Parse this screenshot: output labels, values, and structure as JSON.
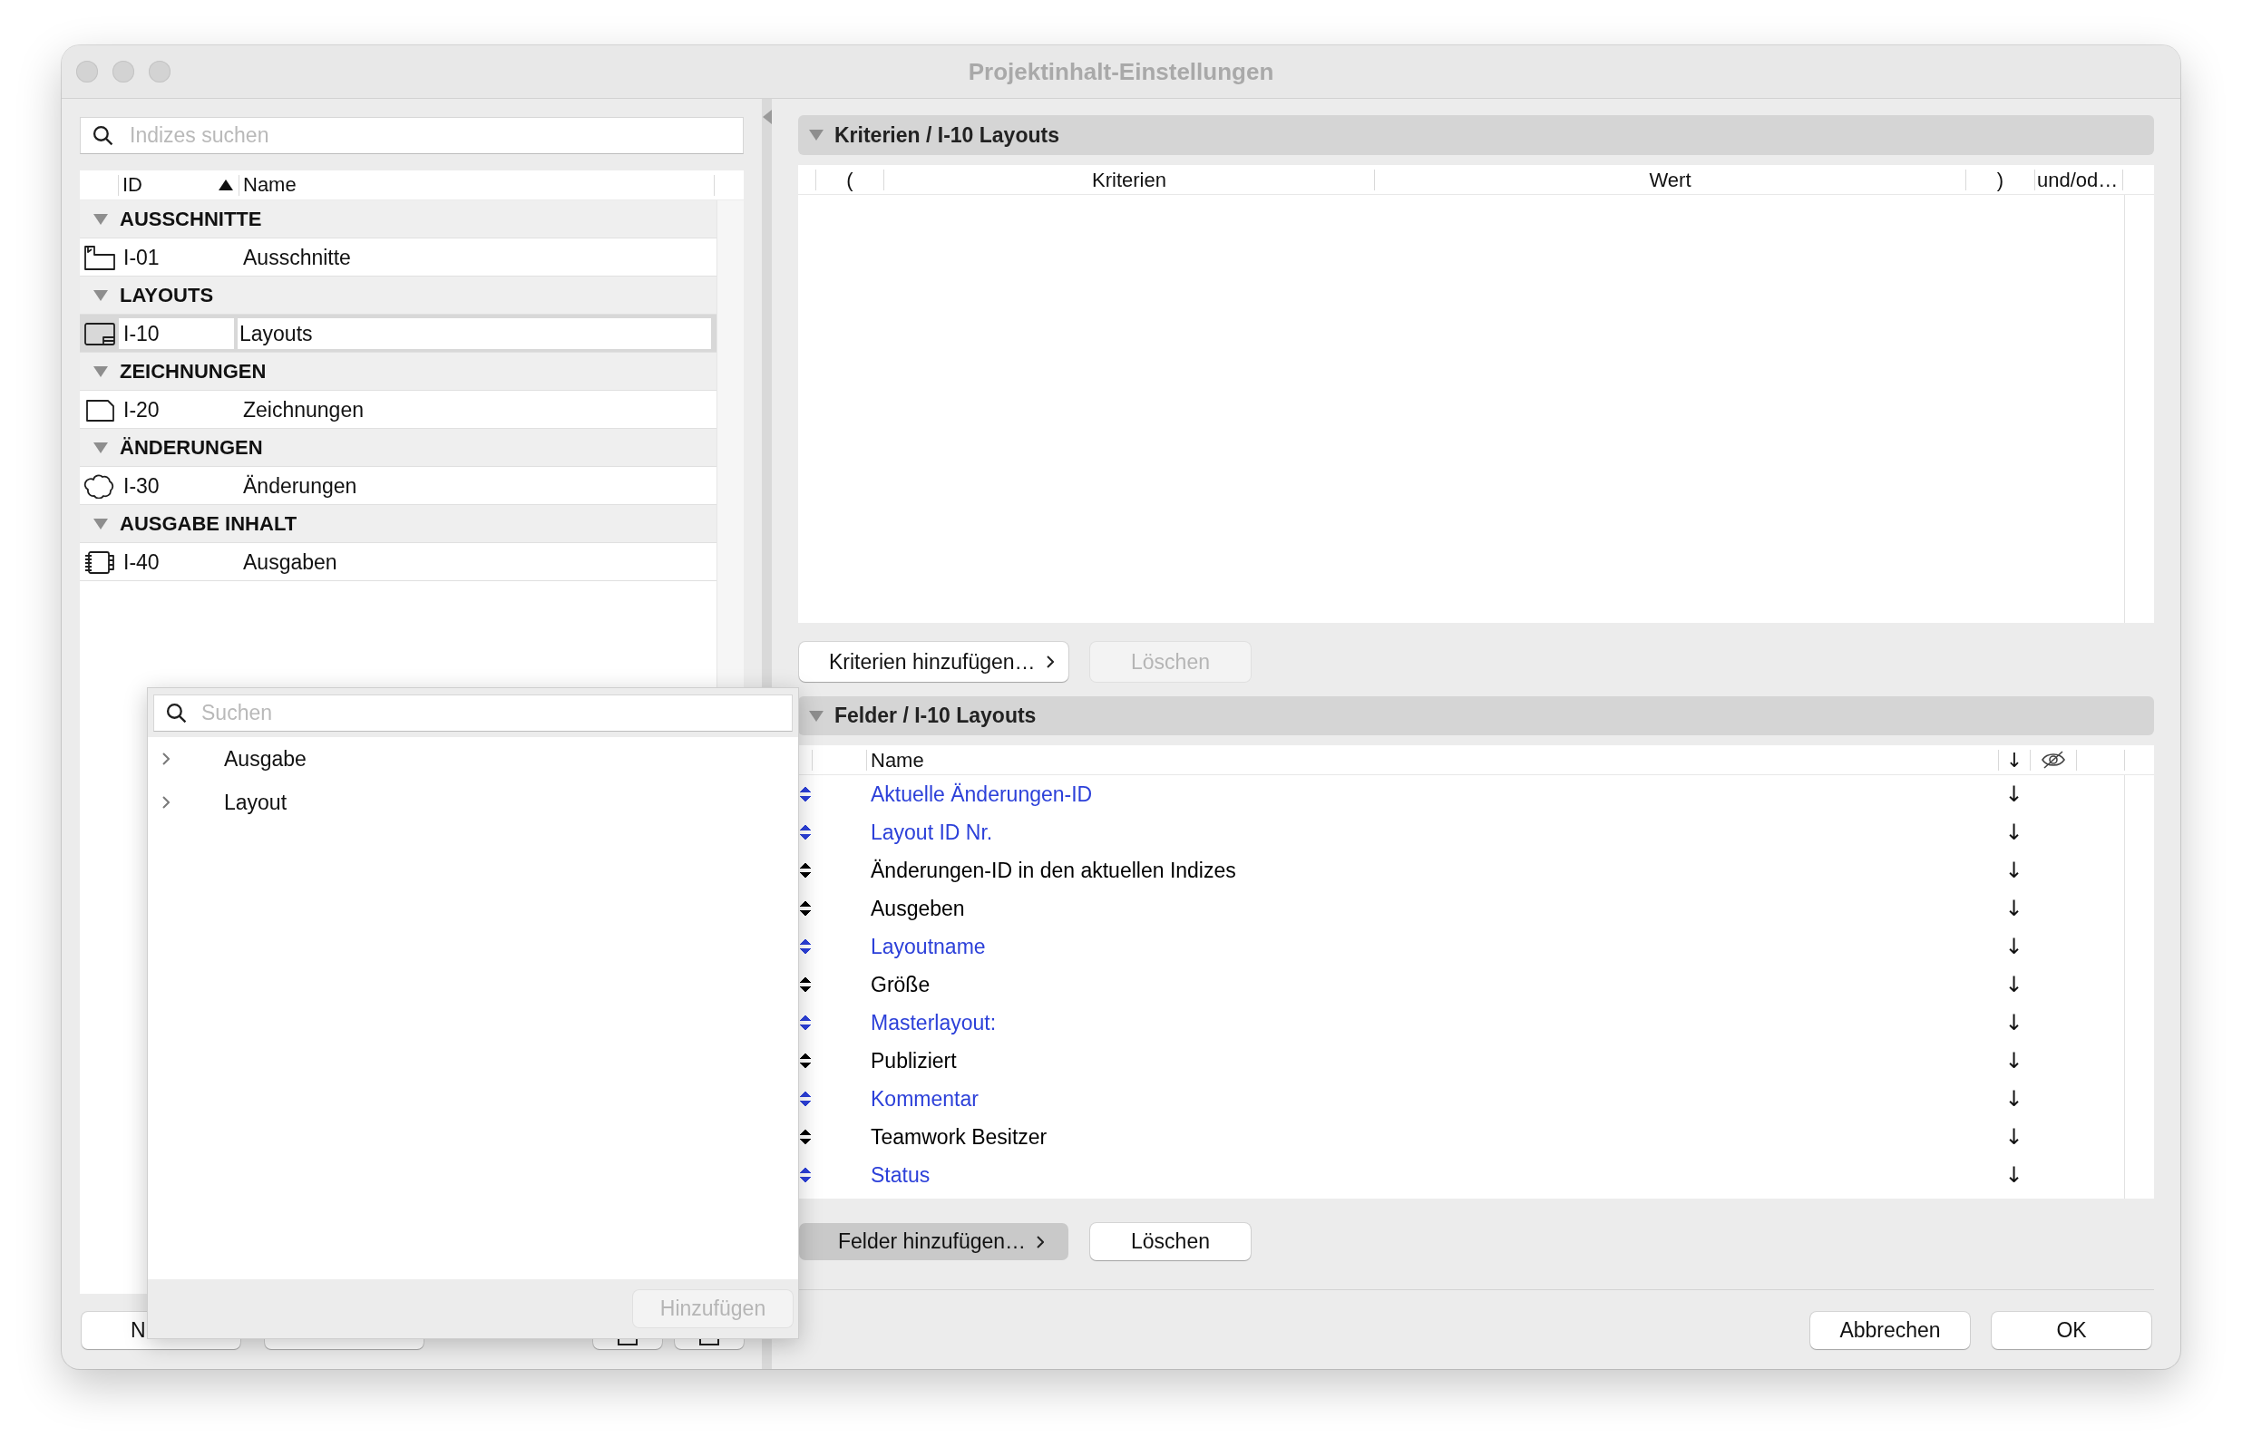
{
  "window": {
    "title": "Projektinhalt-Einstellungen"
  },
  "index_panel": {
    "search": {
      "placeholder": "Indizes suchen"
    },
    "columns": [
      {
        "label": "ID",
        "sorted": true
      },
      {
        "label": "Name",
        "sorted": false
      }
    ],
    "groups": [
      {
        "label": "AUSSCHNITTE",
        "expanded": true,
        "items": [
          {
            "kind": "detail",
            "id": "I-01",
            "name": "Ausschnitte",
            "selected": false
          }
        ]
      },
      {
        "label": "LAYOUTS",
        "expanded": true,
        "items": [
          {
            "kind": "layout",
            "id": "I-10",
            "name": "Layouts",
            "selected": true
          }
        ]
      },
      {
        "label": "ZEICHNUNGEN",
        "expanded": true,
        "items": [
          {
            "kind": "drawing",
            "id": "I-20",
            "name": "Zeichnungen",
            "selected": false
          }
        ]
      },
      {
        "label": "ÄNDERUNGEN",
        "expanded": true,
        "items": [
          {
            "kind": "revision",
            "id": "I-30",
            "name": "Änderungen",
            "selected": false
          }
        ]
      },
      {
        "label": "AUSGABE INHALT",
        "expanded": true,
        "items": [
          {
            "kind": "issue",
            "id": "I-40",
            "name": "Ausgaben",
            "selected": false
          }
        ]
      }
    ],
    "footer_buttons": [
      {
        "kind": "text",
        "label": "N"
      },
      {
        "kind": "plain"
      },
      {
        "kind": "icon"
      },
      {
        "kind": "icon"
      }
    ]
  },
  "field_picker": {
    "search": {
      "placeholder": "Suchen"
    },
    "items": [
      {
        "label": "Ausgabe",
        "expanded": false
      },
      {
        "label": "Layout",
        "expanded": false
      }
    ],
    "add_button": {
      "label": "Hinzufügen",
      "disabled": true
    }
  },
  "criteria": {
    "title": "Kriterien / I-10 Layouts",
    "expanded": true,
    "columns": [
      "(",
      "Kriterien",
      "Wert",
      ")",
      "und/od…"
    ],
    "add_button": {
      "label": "Kriterien hinzufügen…",
      "pressed": false
    },
    "delete_button": {
      "label": "Löschen",
      "disabled": true
    }
  },
  "fields": {
    "title": "Felder / I-10 Layouts",
    "expanded": true,
    "columns": {
      "name": "Name",
      "column_2": "↓"
    },
    "rows": [
      {
        "name": "Aktuelle Änderungen-ID",
        "color": "#2c40d9",
        "column_2": "↓"
      },
      {
        "name": "Layout ID Nr.",
        "color": "#2c40d9",
        "column_2": "↓"
      },
      {
        "name": "Änderungen-ID in den aktuellen Indizes",
        "color": "#000000",
        "column_2": "↓"
      },
      {
        "name": "Ausgeben",
        "color": "#000000",
        "column_2": "↓"
      },
      {
        "name": "Layoutname",
        "color": "#2c40d9",
        "column_2": "↓"
      },
      {
        "name": "Größe",
        "color": "#000000",
        "column_2": "↓"
      },
      {
        "name": "Masterlayout:",
        "color": "#2c40d9",
        "column_2": "↓"
      },
      {
        "name": "Publiziert",
        "color": "#000000",
        "column_2": "↓"
      },
      {
        "name": "Kommentar",
        "color": "#2c40d9",
        "column_2": "↓"
      },
      {
        "name": "Teamwork Besitzer",
        "color": "#000000",
        "column_2": "↓"
      },
      {
        "name": "Status",
        "color": "#2c40d9",
        "column_2": "↓"
      }
    ],
    "add_button": {
      "label": "Felder hinzufügen…",
      "pressed": true
    },
    "delete_button": {
      "label": "Löschen",
      "disabled": false
    }
  },
  "dialog_buttons": [
    {
      "label": "Abbrechen"
    },
    {
      "label": "OK"
    }
  ]
}
